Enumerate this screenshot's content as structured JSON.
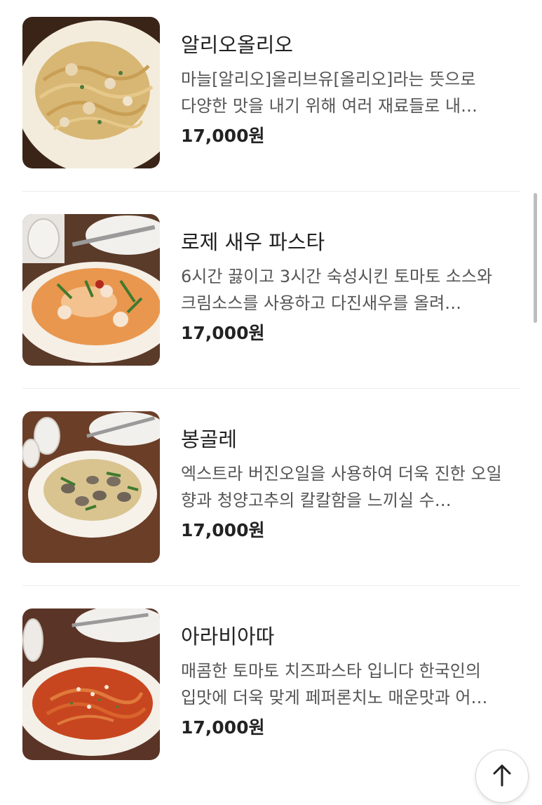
{
  "menu": {
    "items": [
      {
        "name": "알리오올리오",
        "description": "마늘[알리오]올리브유[올리오]라는 뜻으로 다양한 맛을 내기 위해 여러 재료들로 내…",
        "price": "17,000원",
        "image_icon": "pasta-aglio-olio-image"
      },
      {
        "name": "로제 새우 파스타",
        "description": "6시간 끓이고 3시간 숙성시킨 토마토 소스와 크림소스를 사용하고 다진새우를 올려…",
        "price": "17,000원",
        "image_icon": "rose-shrimp-pasta-image"
      },
      {
        "name": "봉골레",
        "description": "엑스트라 버진오일을 사용하여 더욱 진한 오일 향과 청양고추의 칼칼함을 느끼실 수…",
        "price": "17,000원",
        "image_icon": "vongole-pasta-image"
      },
      {
        "name": "아라비아따",
        "description": "매콤한 토마토 치즈파스타 입니다 한국인의 입맛에 더욱 맞게 페퍼론치노 매운맛과 어…",
        "price": "17,000원",
        "image_icon": "arrabbiata-pasta-image"
      }
    ]
  },
  "scroll_top_button": {
    "icon": "arrow-up-icon"
  },
  "colors": {
    "price": "#222222",
    "description": "#555555",
    "divider": "#ececec"
  }
}
